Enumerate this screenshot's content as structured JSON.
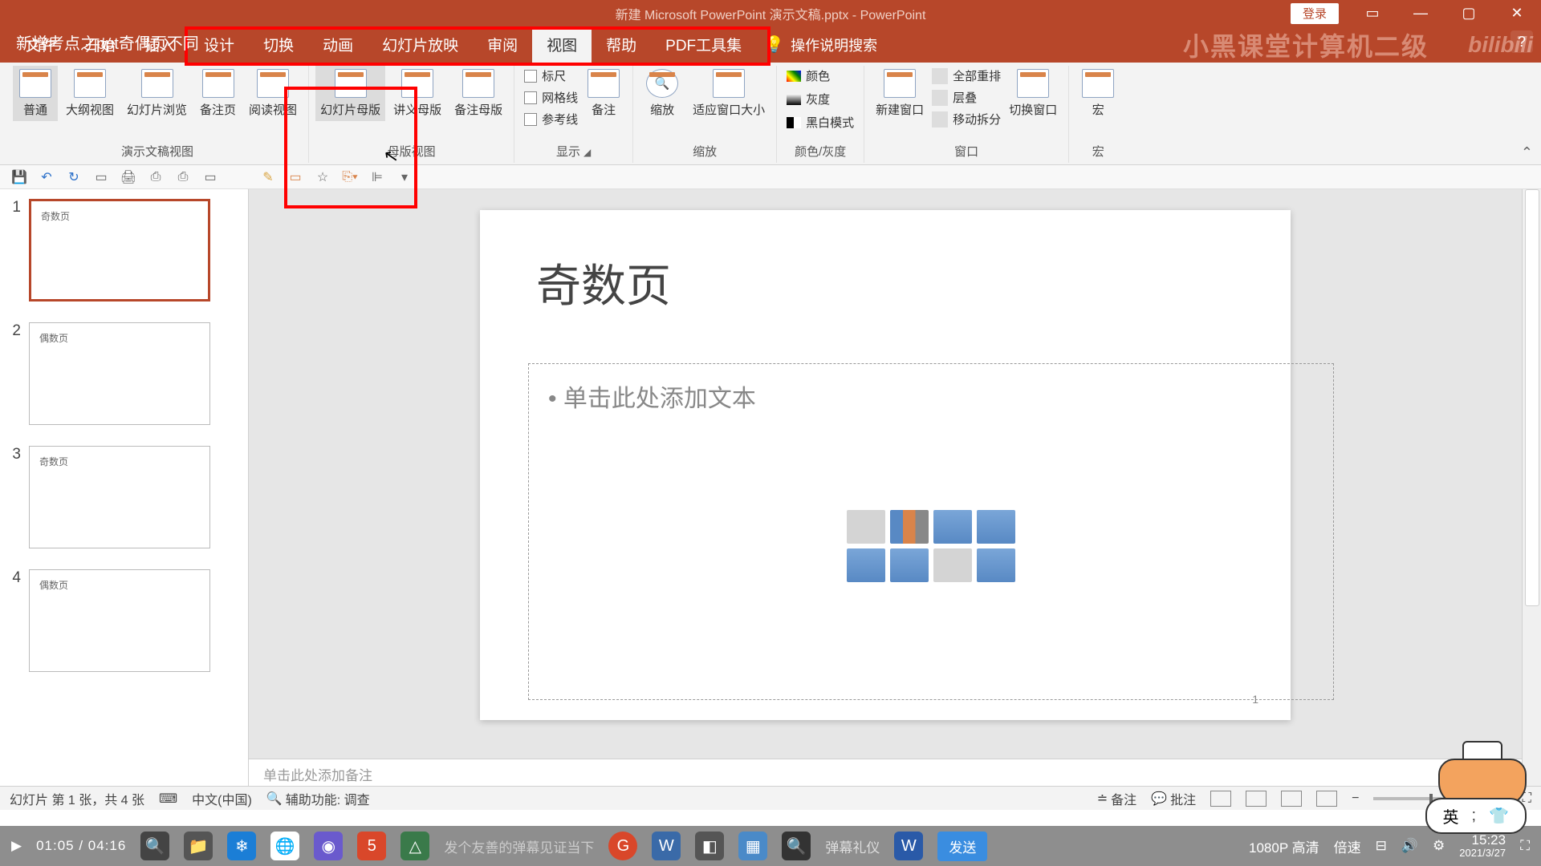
{
  "title_bar": {
    "lesson_title": "新增考点之ppt奇偶页不同",
    "doc_title": "新建 Microsoft PowerPoint 演示文稿.pptx - PowerPoint",
    "login": "登录"
  },
  "tabs": {
    "file": "文件",
    "home": "开始",
    "insert": "插入",
    "design": "设计",
    "transitions": "切换",
    "animations": "动画",
    "slideshow": "幻灯片放映",
    "review": "审阅",
    "view": "视图",
    "help": "帮助",
    "pdf": "PDF工具集",
    "tell_me": "操作说明搜索"
  },
  "watermark": {
    "brand": "小黑课堂计算机二级",
    "site": "bilibili"
  },
  "ribbon": {
    "presentation_views": {
      "normal": "普通",
      "outline": "大纲视图",
      "sorter": "幻灯片浏览",
      "notes_page": "备注页",
      "reading": "阅读视图",
      "group": "演示文稿视图"
    },
    "master_views": {
      "slide_master": "幻灯片母版",
      "handout_master": "讲义母版",
      "notes_master": "备注母版",
      "group": "母版视图"
    },
    "show": {
      "ruler": "标尺",
      "gridlines": "网格线",
      "guides": "参考线",
      "notes": "备注",
      "group": "显示"
    },
    "zoom": {
      "zoom": "缩放",
      "fit": "适应窗口大小",
      "group": "缩放"
    },
    "color": {
      "color": "颜色",
      "grayscale": "灰度",
      "bw": "黑白模式",
      "group": "颜色/灰度"
    },
    "window": {
      "new_window": "新建窗口",
      "arrange_all": "全部重排",
      "cascade": "层叠",
      "move_split": "移动拆分",
      "switch": "切换窗口",
      "group": "窗口"
    },
    "macros": {
      "macros": "宏",
      "group": "宏"
    }
  },
  "thumbs": [
    {
      "num": "1",
      "text": "奇数页",
      "active": true
    },
    {
      "num": "2",
      "text": "偶数页",
      "active": false
    },
    {
      "num": "3",
      "text": "奇数页",
      "active": false
    },
    {
      "num": "4",
      "text": "偶数页",
      "active": false
    }
  ],
  "slide": {
    "title": "奇数页",
    "bullet": "• 单击此处添加文本",
    "page_num": "1"
  },
  "notes_placeholder": "单击此处添加备注",
  "status": {
    "slide_info": "幻灯片 第 1 张，共 4 张",
    "lang": "中文(中国)",
    "accessibility": "辅助功能: 调查",
    "notes": "备注",
    "comments": "批注"
  },
  "taskbar": {
    "video_time": "01:05 / 04:16",
    "danmu_text": "发个友善的弹幕见证当下",
    "send": "发送",
    "quality": "1080P 高清",
    "speed": "倍速",
    "clock": "15:23",
    "date": "2021/3/27"
  },
  "ime": {
    "lang": "英",
    "icon": "👕"
  }
}
